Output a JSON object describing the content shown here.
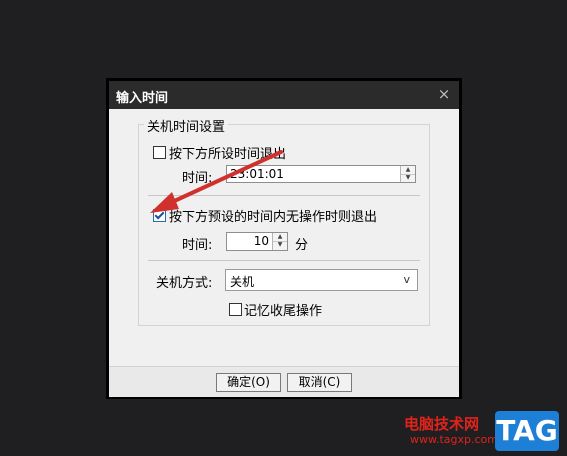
{
  "dialog": {
    "title": "输入时间",
    "close_glyph": "×",
    "group_title": "关机时间设置",
    "option1": {
      "label": "按下方所设时间退出",
      "checked": false,
      "time_label": "时间:",
      "time_value": "23:01:01"
    },
    "option2": {
      "label": "按下方预设的时间内无操作时则退出",
      "checked": true,
      "time_label": "时间:",
      "minutes_value": "10",
      "unit": "分"
    },
    "shutdown": {
      "label": "关机方式:",
      "value": "关机",
      "chevron": "v"
    },
    "remember": {
      "label": "记忆收尾操作",
      "checked": false
    },
    "buttons": {
      "ok": "确定(O)",
      "cancel": "取消(C)"
    }
  },
  "watermark": {
    "site_name": "电脑技术网",
    "url": "www.tagxp.com",
    "tag": "TAG"
  },
  "colors": {
    "annotation_arrow": "#d0312d",
    "watermark_red": "#e0231a",
    "watermark_blue": "#1e7fd6"
  }
}
